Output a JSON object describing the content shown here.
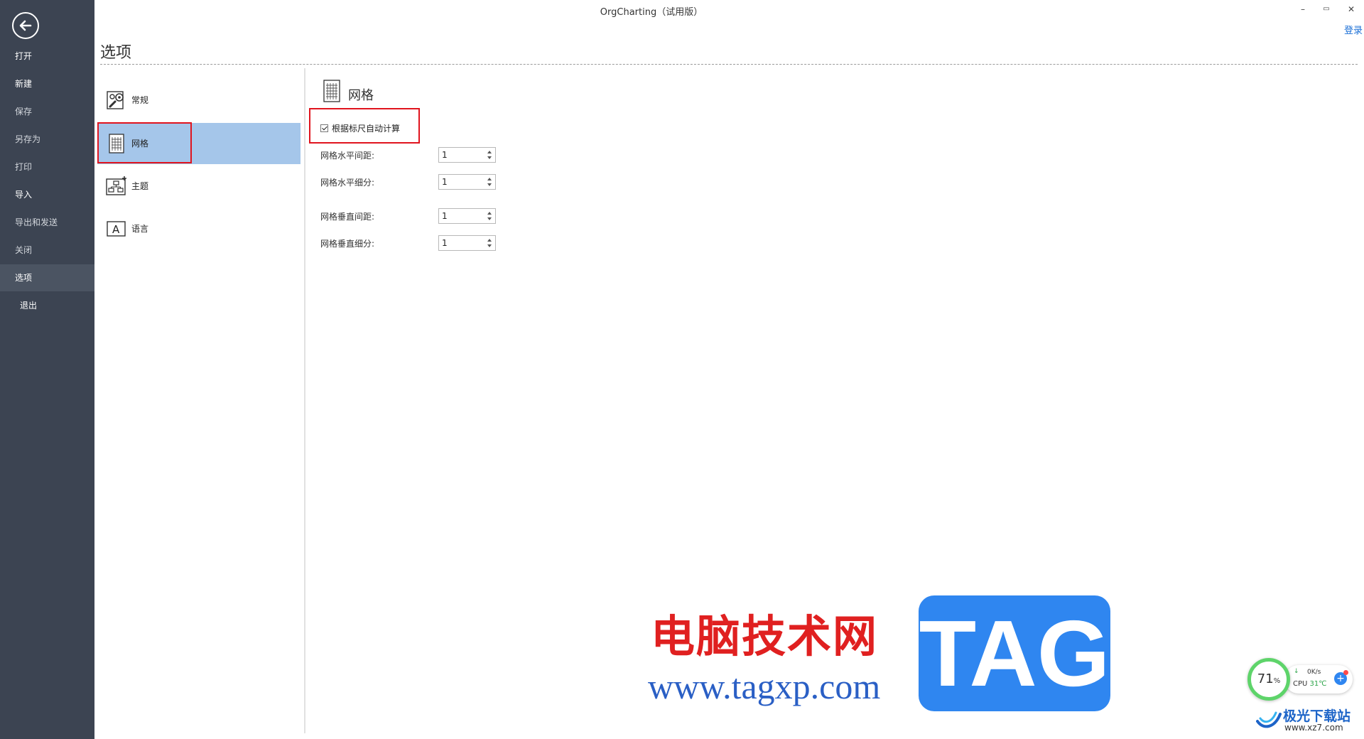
{
  "window": {
    "title": "OrgCharting（试用版）",
    "controls": {
      "minimize": "–",
      "restore": "▭",
      "close": "✕"
    },
    "login": "登录"
  },
  "sidebar": {
    "items": [
      {
        "label": "打开"
      },
      {
        "label": "新建"
      },
      {
        "label": "保存"
      },
      {
        "label": "另存为"
      },
      {
        "label": "打印"
      },
      {
        "label": "导入"
      },
      {
        "label": "导出和发送"
      },
      {
        "label": "关闭"
      },
      {
        "label": "选项"
      },
      {
        "label": "退出"
      }
    ]
  },
  "options": {
    "title": "选项",
    "categories": [
      {
        "label": "常规",
        "icon": "settings-wrench-icon"
      },
      {
        "label": "网格",
        "icon": "grid-icon",
        "selected": true
      },
      {
        "label": "主题",
        "icon": "theme-orgchart-icon"
      },
      {
        "label": "语言",
        "icon": "language-icon"
      }
    ]
  },
  "grid_panel": {
    "heading": "网格",
    "auto_calc": {
      "label": "根据标尺自动计算",
      "checked": true
    },
    "fields": [
      {
        "label": "网格水平间距:",
        "value": "1"
      },
      {
        "label": "网格水平细分:",
        "value": "1"
      },
      {
        "label": "网格垂直间距:",
        "value": "1"
      },
      {
        "label": "网格垂直细分:",
        "value": "1"
      }
    ]
  },
  "watermark": {
    "site_name": "电脑技术网",
    "url": "www.tagxp.com",
    "badge": "TAG",
    "xz_name": "极光下载站",
    "xz_url": "www.xz7.com"
  },
  "cpu_widget": {
    "percent": "71",
    "percent_unit": "%",
    "net_speed": "0K/s",
    "cpu_label": "CPU",
    "temp": "31℃"
  }
}
